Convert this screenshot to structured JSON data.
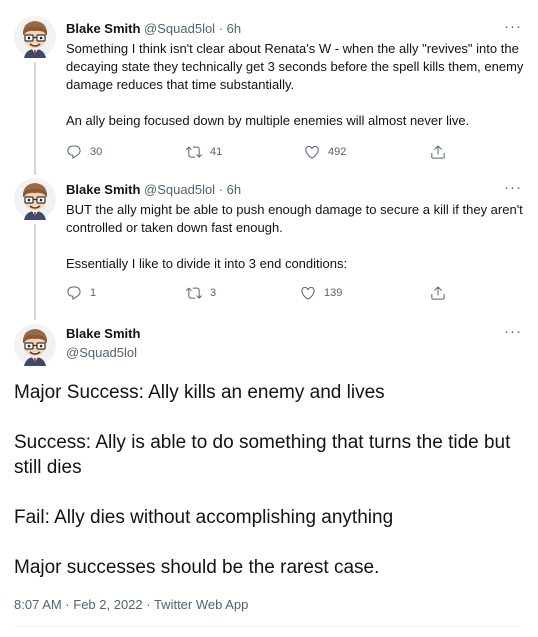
{
  "tweets": [
    {
      "name": "Blake Smith",
      "handle": "@Squad5lol",
      "separator": "·",
      "time": "6h",
      "more": "···",
      "paragraphs": [
        "Something I think isn't clear about Renata's W - when the ally \"revives\" into the decaying state they technically get 3 seconds before the spell kills them, enemy damage reduces that time substantially.",
        "An ally being focused down by multiple enemies will almost never live."
      ],
      "replies": "30",
      "retweets": "41",
      "likes": "492"
    },
    {
      "name": "Blake Smith",
      "handle": "@Squad5lol",
      "separator": "·",
      "time": "6h",
      "more": "···",
      "paragraphs": [
        "BUT the ally might be able to push enough damage to secure a kill if they aren't controlled or taken down fast enough.",
        "Essentially I like to divide it into 3 end conditions:"
      ],
      "replies": "1",
      "retweets": "3",
      "likes": "139"
    }
  ],
  "main_tweet": {
    "name": "Blake Smith",
    "handle": "@Squad5lol",
    "more": "···",
    "paragraphs": [
      "Major Success: Ally kills an enemy and lives",
      "Success: Ally is able to do something that turns the tide but still dies",
      "Fail: Ally dies without accomplishing anything",
      "Major successes should be the rarest case."
    ],
    "meta": "8:07 AM · Feb 2, 2022 · Twitter Web App"
  },
  "icons": {
    "reply": "reply-icon",
    "retweet": "retweet-icon",
    "like": "heart-icon",
    "share": "share-icon",
    "more": "more-icon",
    "avatar": "cartoon-avatar"
  },
  "colors": {
    "text": "#0f1419",
    "secondary": "#536471",
    "thread_line": "#cfd9de"
  }
}
